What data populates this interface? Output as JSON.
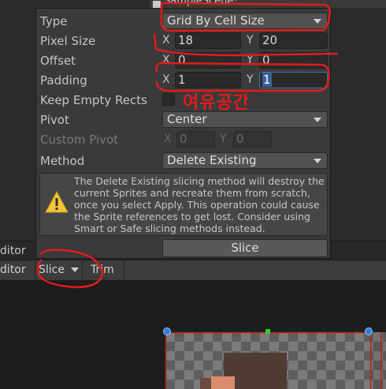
{
  "scene_tab": {
    "label": "SampleScene*"
  },
  "popup": {
    "type": {
      "label": "Type",
      "value": "Grid By Cell Size"
    },
    "pixel_size": {
      "label": "Pixel Size",
      "x_label": "X",
      "x": "18",
      "y_label": "Y",
      "y": "20"
    },
    "offset": {
      "label": "Offset",
      "x_label": "X",
      "x": "0",
      "y_label": "Y",
      "y": "0"
    },
    "padding": {
      "label": "Padding",
      "x_label": "X",
      "x": "1",
      "y_label": "Y",
      "y": "1"
    },
    "keep_empty_rects": {
      "label": "Keep Empty Rects",
      "checked": false
    },
    "pivot": {
      "label": "Pivot",
      "value": "Center"
    },
    "custom_pivot": {
      "label": "Custom Pivot",
      "x_label": "X",
      "x": "0",
      "y_label": "Y",
      "y": "0"
    },
    "method": {
      "label": "Method",
      "value": "Delete Existing"
    },
    "warning": {
      "icon": "warning-icon",
      "text": "The Delete Existing slicing method will destroy the current Sprites and recreate them from scratch, once you select Apply. This operation could cause the Sprite references to get lost. Consider using Smart or Safe slicing methods instead."
    },
    "slice_button": "Slice"
  },
  "editor": {
    "tab_label": "ditor",
    "toolbar": {
      "mode_label": "ditor",
      "slice_menu": "Slice",
      "trim_button": "Trim"
    }
  },
  "annotation": {
    "text": "여유공간",
    "color": "#e31b1b"
  }
}
